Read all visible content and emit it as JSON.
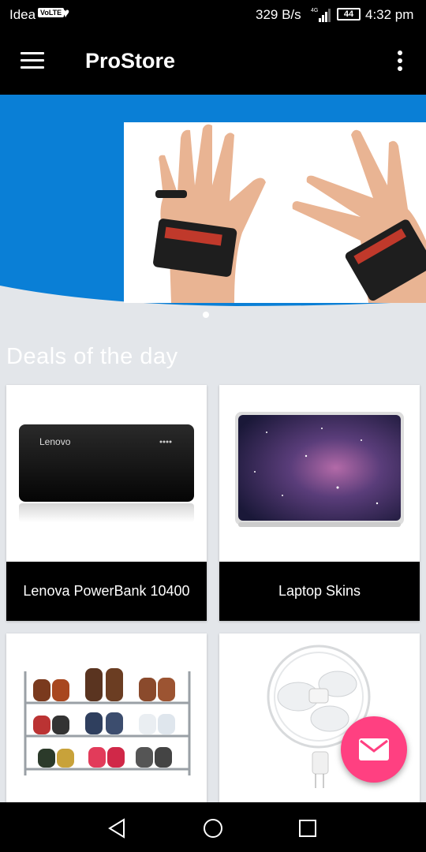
{
  "status_bar": {
    "carrier": "Idea",
    "volte": "VoLTE",
    "speed": "329 B/s",
    "network": "4G",
    "battery": "44",
    "time": "4:32 pm"
  },
  "app_bar": {
    "title": "ProStore",
    "menu_icon": "hamburger-menu-icon",
    "overflow_icon": "more-vert-icon"
  },
  "banner": {
    "image": "wrist-wrap-straps-photo",
    "slide_index": 1,
    "colors": {
      "wave": "#0a7fd6",
      "background": "#e3e6ea"
    }
  },
  "section_title": "Deals of the day",
  "products": [
    {
      "name": "Lenova PowerBank 10400",
      "image": "lenovo-powerbank-photo",
      "brand_text": "Lenovo"
    },
    {
      "name": "Laptop Skins",
      "image": "galaxy-laptop-skin-photo"
    },
    {
      "name": "",
      "image": "shoe-rack-photo"
    },
    {
      "name": "",
      "image": "wall-fan-photo"
    }
  ],
  "fab": {
    "icon": "mail-icon",
    "color": "#ff4081"
  },
  "nav_bar": {
    "back_icon": "back-icon",
    "home_icon": "home-icon",
    "recents_icon": "recents-icon"
  }
}
